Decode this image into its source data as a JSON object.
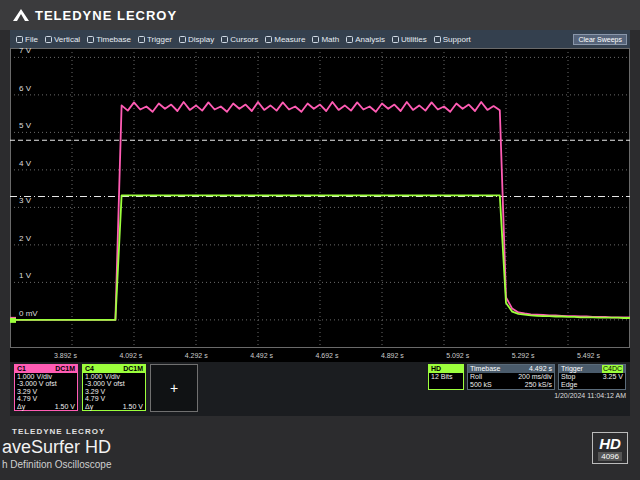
{
  "brand": {
    "top_logo": "TELEDYNE LECROY",
    "bottom_logo": "TELEDYNE LECROY",
    "model": "aveSurfer HD",
    "subtitle": "h Definition Oscilloscope",
    "badge_top": "HD",
    "badge_bottom": "4096"
  },
  "menu": {
    "items": [
      "File",
      "Vertical",
      "Timebase",
      "Trigger",
      "Display",
      "Cursors",
      "Measure",
      "Math",
      "Analysis",
      "Utilities",
      "Support"
    ],
    "clear_button": "Clear Sweeps"
  },
  "chart": {
    "y_ticks": [
      "7 V",
      "6 V",
      "5 V",
      "4 V",
      "3 V",
      "2 V",
      "1 V",
      "0 mV"
    ],
    "x_ticks": [
      "3.892 s",
      "4.092 s",
      "4.292 s",
      "4.492 s",
      "4.692 s",
      "4.892 s",
      "5.092 s",
      "5.292 s",
      "5.492 s"
    ],
    "series": [
      {
        "name": "C1",
        "color": "#ff5cb4",
        "values": [
          0,
          0,
          0,
          0,
          0,
          0,
          0,
          0,
          0,
          0,
          0,
          0,
          0,
          0,
          0,
          0,
          0,
          0,
          5.72,
          5.58,
          5.8,
          5.61,
          5.69,
          5.55,
          5.77,
          5.63,
          5.74,
          5.57,
          5.81,
          5.6,
          5.72,
          5.58,
          5.8,
          5.61,
          5.69,
          5.55,
          5.77,
          5.63,
          5.74,
          5.57,
          5.81,
          5.6,
          5.72,
          5.58,
          5.8,
          5.61,
          5.69,
          5.55,
          5.77,
          5.63,
          5.74,
          5.57,
          5.81,
          5.6,
          5.72,
          5.58,
          5.8,
          5.61,
          5.69,
          5.55,
          5.77,
          5.63,
          5.74,
          5.57,
          5.81,
          5.6,
          5.72,
          5.58,
          5.8,
          5.61,
          5.69,
          5.55,
          5.77,
          5.63,
          5.74,
          5.57,
          5.81,
          5.6,
          5.7,
          5.59,
          0.6,
          0.3,
          0.2,
          0.17,
          0.15,
          0.14,
          0.13,
          0.12,
          0.12,
          0.11,
          0.1,
          0.1,
          0.09,
          0.09,
          0.08,
          0.08,
          0.08,
          0.07,
          0.07,
          0.07,
          0.07
        ]
      },
      {
        "name": "C4",
        "color": "#9cff3c",
        "values": [
          0,
          0,
          0,
          0,
          0,
          0,
          0,
          0,
          0,
          0,
          0,
          0,
          0,
          0,
          0,
          0,
          0,
          0,
          3.32,
          3.32,
          3.32,
          3.32,
          3.32,
          3.32,
          3.32,
          3.32,
          3.32,
          3.32,
          3.32,
          3.32,
          3.32,
          3.32,
          3.32,
          3.32,
          3.32,
          3.32,
          3.32,
          3.32,
          3.32,
          3.32,
          3.32,
          3.32,
          3.32,
          3.32,
          3.32,
          3.32,
          3.32,
          3.32,
          3.32,
          3.32,
          3.32,
          3.32,
          3.32,
          3.32,
          3.32,
          3.32,
          3.32,
          3.32,
          3.32,
          3.32,
          3.32,
          3.32,
          3.32,
          3.32,
          3.32,
          3.32,
          3.32,
          3.32,
          3.32,
          3.32,
          3.32,
          3.32,
          3.32,
          3.32,
          3.32,
          3.32,
          3.32,
          3.32,
          3.32,
          3.32,
          0.45,
          0.22,
          0.16,
          0.14,
          0.12,
          0.11,
          0.1,
          0.1,
          0.09,
          0.09,
          0.08,
          0.08,
          0.07,
          0.07,
          0.07,
          0.06,
          0.06,
          0.06,
          0.06,
          0.05,
          0.05
        ]
      }
    ],
    "cursors": [
      {
        "value": 4.79,
        "kind": "dashed"
      },
      {
        "value": 3.29,
        "kind": "dashdot"
      }
    ]
  },
  "channels": [
    {
      "label": "C1",
      "coupling": "DC1M",
      "color": "#ff5cb4",
      "rows": [
        "1.000 V/div",
        "-3.000 V ofst",
        "3.29 V",
        "4.79 V"
      ],
      "delta_label": "Δy",
      "delta_value": "1.50 V"
    },
    {
      "label": "C4",
      "coupling": "DC1M",
      "color": "#9cff3c",
      "rows": [
        "1.000 V/div",
        "-3.000 V ofst",
        "3.29 V",
        "4.79 V"
      ],
      "delta_label": "Δy",
      "delta_value": "1.50 V"
    }
  ],
  "add_button": "+",
  "acquisition": {
    "header": "HD",
    "text": "12 Bits"
  },
  "timebase": {
    "header": "Timebase",
    "header_value": "4.492 s",
    "rows": [
      [
        "Roll",
        "200 ms/div"
      ],
      [
        "500 kS",
        "250 kS/s"
      ]
    ]
  },
  "trigger": {
    "header": "Trigger",
    "header_value": "C4DC",
    "rows": [
      [
        "Stop",
        "3.25 V"
      ],
      [
        "Edge"
      ]
    ]
  },
  "datetime": "1/20/2024 11:04:12 AM"
}
